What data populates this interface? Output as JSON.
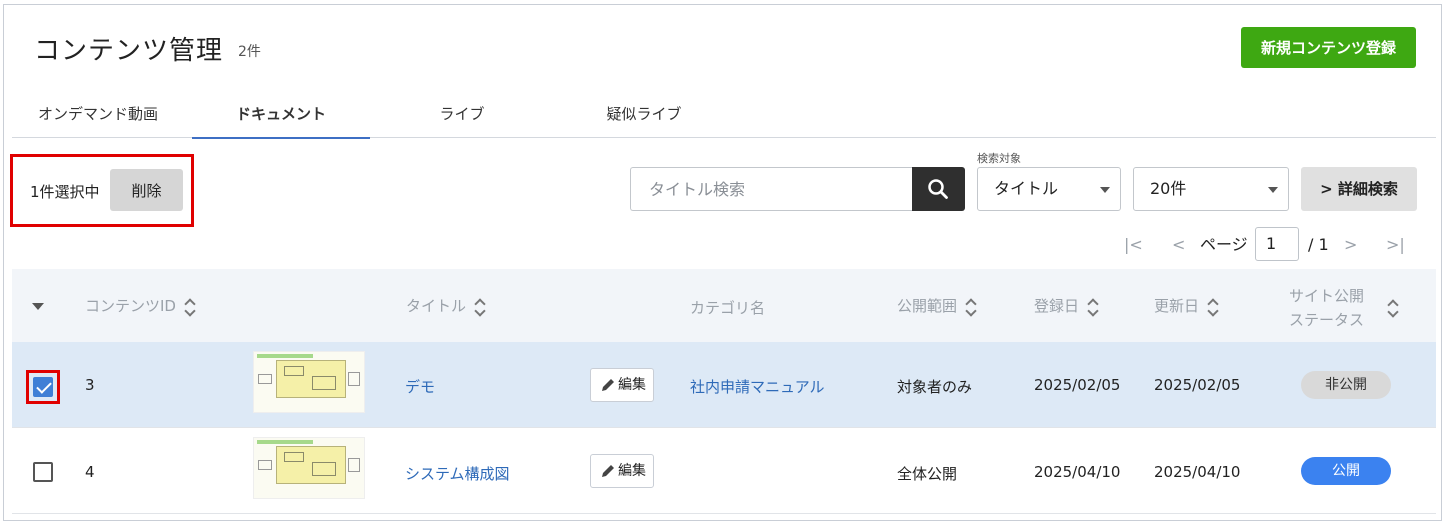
{
  "header": {
    "title": "コンテンツ管理",
    "count": "2件",
    "new_button": "新規コンテンツ登録"
  },
  "tabs": [
    {
      "label": "オンデマンド動画",
      "active": false
    },
    {
      "label": "ドキュメント",
      "active": true
    },
    {
      "label": "ライブ",
      "active": false
    },
    {
      "label": "疑似ライブ",
      "active": false
    }
  ],
  "selection": {
    "text": "1件選択中",
    "delete_label": "削除"
  },
  "search": {
    "placeholder": "タイトル検索",
    "target_label": "検索対象",
    "target_value": "タイトル",
    "per_page": "20件",
    "advanced_label": "詳細検索"
  },
  "pager": {
    "first": "|<",
    "prev": "<",
    "page_label": "ページ",
    "current": "1",
    "total": "/ 1",
    "next": ">",
    "last": ">|"
  },
  "table": {
    "headers": {
      "id": "コンテンツID",
      "title": "タイトル",
      "category": "カテゴリ名",
      "scope": "公開範囲",
      "registered": "登録日",
      "updated": "更新日",
      "status_line1": "サイト公開",
      "status_line2": "ステータス"
    },
    "edit_label": "編集",
    "rows": [
      {
        "selected": true,
        "id": "3",
        "title": "デモ",
        "category": "社内申請マニュアル",
        "scope": "対象者のみ",
        "registered": "2025/02/05",
        "updated": "2025/02/05",
        "status": "非公開"
      },
      {
        "selected": false,
        "id": "4",
        "title": "システム構成図",
        "category": "",
        "scope": "全体公開",
        "registered": "2025/04/10",
        "updated": "2025/04/10",
        "status": "公開"
      }
    ]
  },
  "colors": {
    "primary_green": "#3ea812",
    "accent_blue": "#3e6fc4",
    "link_blue": "#2e6ab8",
    "public_badge": "#3b82f0",
    "highlight_red": "#e00000"
  }
}
